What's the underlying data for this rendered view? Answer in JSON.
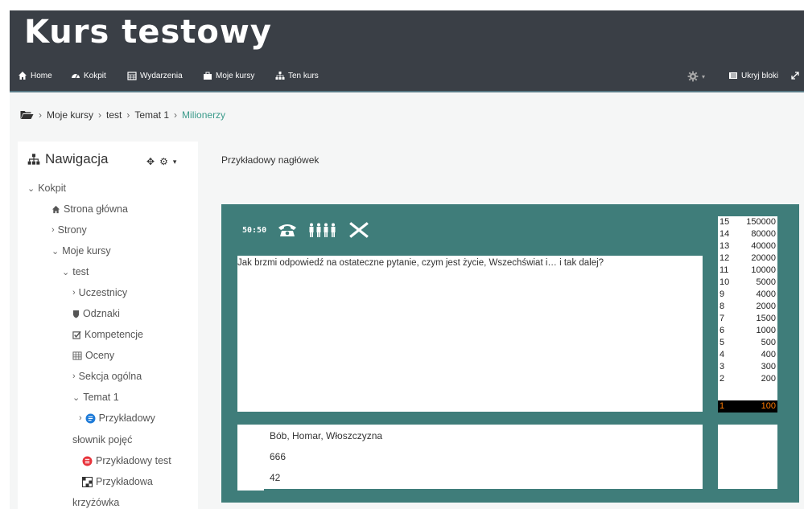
{
  "course_title": "Kurs testowy",
  "nav": {
    "home": "Home",
    "kokpit": "Kokpit",
    "wydarzenia": "Wydarzenia",
    "moje_kursy": "Moje kursy",
    "ten_kurs": "Ten kurs",
    "hide_blocks": "Ukryj bloki"
  },
  "breadcrumb": [
    "Moje kursy",
    "test",
    "Temat 1",
    "Milionerzy"
  ],
  "sidebar": {
    "title": "Nawigacja",
    "items": [
      {
        "label": "Kokpit",
        "chevron": "⌄"
      },
      {
        "label": "Strona główna",
        "icon": "home-icon"
      },
      {
        "label": "Strony",
        "chevron": "›"
      },
      {
        "label": "Moje kursy",
        "chevron": "⌄"
      },
      {
        "label": "test",
        "chevron": "⌄"
      },
      {
        "label": "Uczestnicy",
        "chevron": "›"
      },
      {
        "label": "Odznaki",
        "icon": "shield-icon"
      },
      {
        "label": "Kompetencje",
        "icon": "checkbox-icon"
      },
      {
        "label": "Oceny",
        "icon": "table-icon"
      },
      {
        "label": "Sekcja ogólna",
        "chevron": "›"
      },
      {
        "label": "Temat 1",
        "chevron": "⌄"
      },
      {
        "label": "Przykładowy",
        "icon": "glossary-icon",
        "chevron": "›"
      },
      {
        "label": "słownik pojęć"
      },
      {
        "label": "Przykładowy test",
        "icon": "quiz-icon"
      },
      {
        "label": "Przykładowa",
        "icon": "crossword-icon"
      },
      {
        "label": "krzyżówka"
      }
    ]
  },
  "main": {
    "heading": "Przykładowy nagłówek"
  },
  "game": {
    "lifelines": {
      "fifty_fifty": "50:50"
    },
    "question": "Jak brzmi odpowiedź na ostateczne pytanie, czym jest życie, Wszechświat i… i tak dalej?",
    "answers": [
      "Bób, Homar, Włoszczyzna",
      "666",
      "42"
    ],
    "ladder": [
      {
        "level": "15",
        "amount": "150000"
      },
      {
        "level": "14",
        "amount": "80000"
      },
      {
        "level": "13",
        "amount": "40000"
      },
      {
        "level": "12",
        "amount": "20000"
      },
      {
        "level": "11",
        "amount": "10000"
      },
      {
        "level": "10",
        "amount": "5000"
      },
      {
        "level": "9",
        "amount": "4000"
      },
      {
        "level": "8",
        "amount": "2000"
      },
      {
        "level": "7",
        "amount": "1500"
      },
      {
        "level": "6",
        "amount": "1000"
      },
      {
        "level": "5",
        "amount": "500"
      },
      {
        "level": "4",
        "amount": "400"
      },
      {
        "level": "3",
        "amount": "300"
      },
      {
        "level": "2",
        "amount": "200"
      },
      {
        "level": "1",
        "amount": "100"
      }
    ],
    "current_level": "1"
  },
  "colors": {
    "header_bg": "#3a3f46",
    "game_bg": "#3f7d7a",
    "active_crumb": "#3a9a8a",
    "ladder_current_text": "#ff7a00"
  }
}
